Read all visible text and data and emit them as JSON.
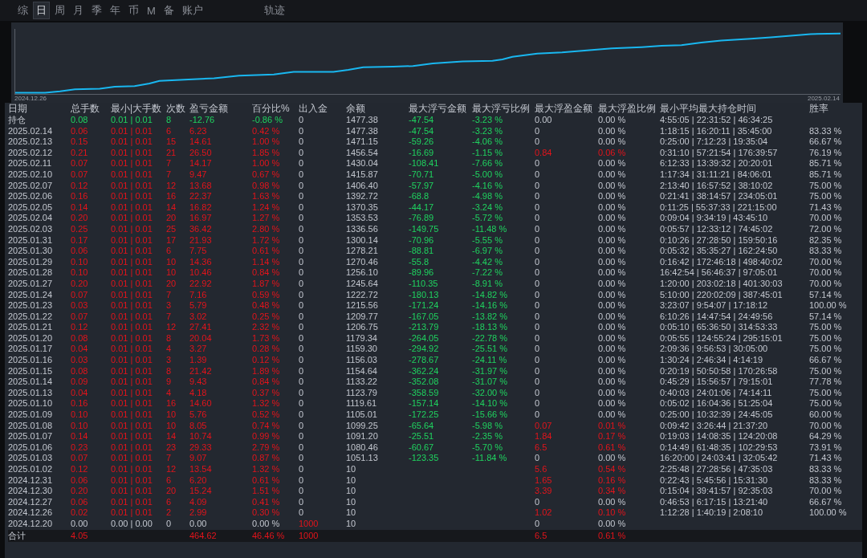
{
  "tabs": [
    {
      "label": "综",
      "selected": false
    },
    {
      "label": "日",
      "selected": true
    },
    {
      "label": "周",
      "selected": false
    },
    {
      "label": "月",
      "selected": false
    },
    {
      "label": "季",
      "selected": false
    },
    {
      "label": "年",
      "selected": false
    },
    {
      "label": "币",
      "selected": false
    },
    {
      "label": "M",
      "selected": false
    },
    {
      "label": "备",
      "selected": false
    },
    {
      "label": "账户",
      "selected": false
    }
  ],
  "view_label": "轨迹",
  "chart": {
    "start_label": "2024.12.26",
    "end_label": "2025.02.14"
  },
  "columns": [
    "日期",
    "总手数",
    "最小|大手数",
    "次数",
    "盈亏金额",
    "百分比%",
    "出入金",
    "余额",
    "最大浮亏金额",
    "最大浮亏比例",
    "最大浮盈金额",
    "最大浮盈比例",
    "最小平均最大持仓时间",
    "胜率"
  ],
  "rows": [
    {
      "kind": "open",
      "date": "持仓",
      "lots": "0.08",
      "lot_range": "0.01 | 0.01",
      "trades": "8",
      "profit": "-12.76",
      "profit_pct": "-0.86 %",
      "deposit": "0",
      "balance": "1477.38",
      "max_float_loss": "-47.54",
      "max_float_loss_pct": "-3.23 %",
      "max_float_profit": "0.00",
      "max_float_profit_pct": "0.00 %",
      "float_profit_up": false,
      "hold_times": "4:55:05 | 22:31:52 | 46:34:25"
    },
    {
      "kind": "day",
      "date": "2025.02.14",
      "lots": "0.06",
      "lot_range": "0.01 | 0.01",
      "trades": "6",
      "profit": "6.23",
      "profit_pct": "0.42 %",
      "deposit": "0",
      "balance": "1477.38",
      "max_float_loss": "-47.54",
      "max_float_loss_pct": "-3.23 %",
      "max_float_profit": "0",
      "max_float_profit_pct": "0.00 %",
      "float_profit_up": false,
      "hold_times": "1:18:15 | 16:20:11 | 35:45:00",
      "win_rate": "83.33 %"
    },
    {
      "kind": "day",
      "date": "2025.02.13",
      "lots": "0.15",
      "lot_range": "0.01 | 0.01",
      "trades": "15",
      "profit": "14.61",
      "profit_pct": "1.00 %",
      "deposit": "0",
      "balance": "1471.15",
      "max_float_loss": "-59.26",
      "max_float_loss_pct": "-4.06 %",
      "max_float_profit": "0",
      "max_float_profit_pct": "0.00 %",
      "float_profit_up": false,
      "hold_times": "0:25:00 | 7:12:23 | 19:35:04",
      "win_rate": "66.67 %"
    },
    {
      "kind": "day",
      "date": "2025.02.12",
      "lots": "0.21",
      "lot_range": "0.01 | 0.01",
      "trades": "21",
      "profit": "26.50",
      "profit_pct": "1.85 %",
      "deposit": "0",
      "balance": "1456.54",
      "max_float_loss": "-16.69",
      "max_float_loss_pct": "-1.15 %",
      "max_float_profit": "0.84",
      "max_float_profit_pct": "0.06 %",
      "float_profit_up": true,
      "hold_times": "0:31:10 | 57:21:54 | 176:39:57",
      "win_rate": "76.19 %"
    },
    {
      "kind": "day",
      "date": "2025.02.11",
      "lots": "0.07",
      "lot_range": "0.01 | 0.01",
      "trades": "7",
      "profit": "14.17",
      "profit_pct": "1.00 %",
      "deposit": "0",
      "balance": "1430.04",
      "max_float_loss": "-108.41",
      "max_float_loss_pct": "-7.66 %",
      "max_float_profit": "0",
      "max_float_profit_pct": "0.00 %",
      "float_profit_up": false,
      "hold_times": "6:12:33 | 13:39:32 | 20:20:01",
      "win_rate": "85.71 %"
    },
    {
      "kind": "day",
      "date": "2025.02.10",
      "lots": "0.07",
      "lot_range": "0.01 | 0.01",
      "trades": "7",
      "profit": "9.47",
      "profit_pct": "0.67 %",
      "deposit": "0",
      "balance": "1415.87",
      "max_float_loss": "-70.71",
      "max_float_loss_pct": "-5.00 %",
      "max_float_profit": "0",
      "max_float_profit_pct": "0.00 %",
      "float_profit_up": false,
      "hold_times": "1:17:34 | 31:11:21 | 84:06:01",
      "win_rate": "85.71 %"
    },
    {
      "kind": "day",
      "date": "2025.02.07",
      "lots": "0.12",
      "lot_range": "0.01 | 0.01",
      "trades": "12",
      "profit": "13.68",
      "profit_pct": "0.98 %",
      "deposit": "0",
      "balance": "1406.40",
      "max_float_loss": "-57.97",
      "max_float_loss_pct": "-4.16 %",
      "max_float_profit": "0",
      "max_float_profit_pct": "0.00 %",
      "float_profit_up": false,
      "hold_times": "2:13:40 | 16:57:52 | 38:10:02",
      "win_rate": "75.00 %"
    },
    {
      "kind": "day",
      "date": "2025.02.06",
      "lots": "0.16",
      "lot_range": "0.01 | 0.01",
      "trades": "16",
      "profit": "22.37",
      "profit_pct": "1.63 %",
      "deposit": "0",
      "balance": "1392.72",
      "max_float_loss": "-68.8",
      "max_float_loss_pct": "-4.98 %",
      "max_float_profit": "0",
      "max_float_profit_pct": "0.00 %",
      "float_profit_up": false,
      "hold_times": "0:21:41 | 38:14:57 | 234:05:01",
      "win_rate": "75.00 %"
    },
    {
      "kind": "day",
      "date": "2025.02.05",
      "lots": "0.14",
      "lot_range": "0.01 | 0.01",
      "trades": "14",
      "profit": "16.82",
      "profit_pct": "1.24 %",
      "deposit": "0",
      "balance": "1370.35",
      "max_float_loss": "-44.17",
      "max_float_loss_pct": "-3.24 %",
      "max_float_profit": "0",
      "max_float_profit_pct": "0.00 %",
      "float_profit_up": false,
      "hold_times": "0:11:25 | 55:37:33 | 221:15:00",
      "win_rate": "71.43 %"
    },
    {
      "kind": "day",
      "date": "2025.02.04",
      "lots": "0.20",
      "lot_range": "0.01 | 0.01",
      "trades": "20",
      "profit": "16.97",
      "profit_pct": "1.27 %",
      "deposit": "0",
      "balance": "1353.53",
      "max_float_loss": "-76.89",
      "max_float_loss_pct": "-5.72 %",
      "max_float_profit": "0",
      "max_float_profit_pct": "0.00 %",
      "float_profit_up": false,
      "hold_times": "0:09:04 | 9:34:19 | 43:45:10",
      "win_rate": "70.00 %"
    },
    {
      "kind": "day",
      "date": "2025.02.03",
      "lots": "0.25",
      "lot_range": "0.01 | 0.01",
      "trades": "25",
      "profit": "36.42",
      "profit_pct": "2.80 %",
      "deposit": "0",
      "balance": "1336.56",
      "max_float_loss": "-149.75",
      "max_float_loss_pct": "-11.48 %",
      "max_float_profit": "0",
      "max_float_profit_pct": "0.00 %",
      "float_profit_up": false,
      "hold_times": "0:05:57 | 12:33:12 | 74:45:02",
      "win_rate": "72.00 %"
    },
    {
      "kind": "day",
      "date": "2025.01.31",
      "lots": "0.17",
      "lot_range": "0.01 | 0.01",
      "trades": "17",
      "profit": "21.93",
      "profit_pct": "1.72 %",
      "deposit": "0",
      "balance": "1300.14",
      "max_float_loss": "-70.96",
      "max_float_loss_pct": "-5.55 %",
      "max_float_profit": "0",
      "max_float_profit_pct": "0.00 %",
      "float_profit_up": false,
      "hold_times": "0:10:26 | 27:28:50 | 159:50:16",
      "win_rate": "82.35 %"
    },
    {
      "kind": "day",
      "date": "2025.01.30",
      "lots": "0.06",
      "lot_range": "0.01 | 0.01",
      "trades": "6",
      "profit": "7.75",
      "profit_pct": "0.61 %",
      "deposit": "0",
      "balance": "1278.21",
      "max_float_loss": "-88.81",
      "max_float_loss_pct": "-6.97 %",
      "max_float_profit": "0",
      "max_float_profit_pct": "0.00 %",
      "float_profit_up": false,
      "hold_times": "0:05:32 | 35:35:27 | 162:24:50",
      "win_rate": "83.33 %"
    },
    {
      "kind": "day",
      "date": "2025.01.29",
      "lots": "0.10",
      "lot_range": "0.01 | 0.01",
      "trades": "10",
      "profit": "14.36",
      "profit_pct": "1.14 %",
      "deposit": "0",
      "balance": "1270.46",
      "max_float_loss": "-55.8",
      "max_float_loss_pct": "-4.42 %",
      "max_float_profit": "0",
      "max_float_profit_pct": "0.00 %",
      "float_profit_up": false,
      "hold_times": "0:16:42 | 172:46:18 | 498:40:02",
      "win_rate": "70.00 %"
    },
    {
      "kind": "day",
      "date": "2025.01.28",
      "lots": "0.10",
      "lot_range": "0.01 | 0.01",
      "trades": "10",
      "profit": "10.46",
      "profit_pct": "0.84 %",
      "deposit": "0",
      "balance": "1256.10",
      "max_float_loss": "-89.96",
      "max_float_loss_pct": "-7.22 %",
      "max_float_profit": "0",
      "max_float_profit_pct": "0.00 %",
      "float_profit_up": false,
      "hold_times": "16:42:54 | 56:46:37 | 97:05:01",
      "win_rate": "70.00 %"
    },
    {
      "kind": "day",
      "date": "2025.01.27",
      "lots": "0.20",
      "lot_range": "0.01 | 0.01",
      "trades": "20",
      "profit": "22.92",
      "profit_pct": "1.87 %",
      "deposit": "0",
      "balance": "1245.64",
      "max_float_loss": "-110.35",
      "max_float_loss_pct": "-8.91 %",
      "max_float_profit": "0",
      "max_float_profit_pct": "0.00 %",
      "float_profit_up": false,
      "hold_times": "1:20:00 | 203:02:18 | 401:30:03",
      "win_rate": "70.00 %"
    },
    {
      "kind": "day",
      "date": "2025.01.24",
      "lots": "0.07",
      "lot_range": "0.01 | 0.01",
      "trades": "7",
      "profit": "7.16",
      "profit_pct": "0.59 %",
      "deposit": "0",
      "balance": "1222.72",
      "max_float_loss": "-180.13",
      "max_float_loss_pct": "-14.82 %",
      "max_float_profit": "0",
      "max_float_profit_pct": "0.00 %",
      "float_profit_up": false,
      "hold_times": "5:10:00 | 220:02:09 | 387:45:01",
      "win_rate": "57.14 %"
    },
    {
      "kind": "day",
      "date": "2025.01.23",
      "lots": "0.03",
      "lot_range": "0.01 | 0.01",
      "trades": "3",
      "profit": "5.79",
      "profit_pct": "0.48 %",
      "deposit": "0",
      "balance": "1215.56",
      "max_float_loss": "-171.24",
      "max_float_loss_pct": "-14.16 %",
      "max_float_profit": "0",
      "max_float_profit_pct": "0.00 %",
      "float_profit_up": false,
      "hold_times": "3:23:07 | 9:54:07 | 17:18:12",
      "win_rate": "100.00 %"
    },
    {
      "kind": "day",
      "date": "2025.01.22",
      "lots": "0.07",
      "lot_range": "0.01 | 0.01",
      "trades": "7",
      "profit": "3.02",
      "profit_pct": "0.25 %",
      "deposit": "0",
      "balance": "1209.77",
      "max_float_loss": "-167.05",
      "max_float_loss_pct": "-13.82 %",
      "max_float_profit": "0",
      "max_float_profit_pct": "0.00 %",
      "float_profit_up": false,
      "hold_times": "6:10:26 | 14:47:54 | 24:49:56",
      "win_rate": "57.14 %"
    },
    {
      "kind": "day",
      "date": "2025.01.21",
      "lots": "0.12",
      "lot_range": "0.01 | 0.01",
      "trades": "12",
      "profit": "27.41",
      "profit_pct": "2.32 %",
      "deposit": "0",
      "balance": "1206.75",
      "max_float_loss": "-213.79",
      "max_float_loss_pct": "-18.13 %",
      "max_float_profit": "0",
      "max_float_profit_pct": "0.00 %",
      "float_profit_up": false,
      "hold_times": "0:05:10 | 65:36:50 | 314:53:33",
      "win_rate": "75.00 %"
    },
    {
      "kind": "day",
      "date": "2025.01.20",
      "lots": "0.08",
      "lot_range": "0.01 | 0.01",
      "trades": "8",
      "profit": "20.04",
      "profit_pct": "1.73 %",
      "deposit": "0",
      "balance": "1179.34",
      "max_float_loss": "-264.05",
      "max_float_loss_pct": "-22.78 %",
      "max_float_profit": "0",
      "max_float_profit_pct": "0.00 %",
      "float_profit_up": false,
      "hold_times": "0:05:55 | 124:55:24 | 295:15:01",
      "win_rate": "75.00 %"
    },
    {
      "kind": "day",
      "date": "2025.01.17",
      "lots": "0.04",
      "lot_range": "0.01 | 0.01",
      "trades": "4",
      "profit": "3.27",
      "profit_pct": "0.28 %",
      "deposit": "0",
      "balance": "1159.30",
      "max_float_loss": "-294.92",
      "max_float_loss_pct": "-25.51 %",
      "max_float_profit": "0",
      "max_float_profit_pct": "0.00 %",
      "float_profit_up": false,
      "hold_times": "2:09:36 | 9:56:53 | 30:05:00",
      "win_rate": "75.00 %"
    },
    {
      "kind": "day",
      "date": "2025.01.16",
      "lots": "0.03",
      "lot_range": "0.01 | 0.01",
      "trades": "3",
      "profit": "1.39",
      "profit_pct": "0.12 %",
      "deposit": "0",
      "balance": "1156.03",
      "max_float_loss": "-278.67",
      "max_float_loss_pct": "-24.11 %",
      "max_float_profit": "0",
      "max_float_profit_pct": "0.00 %",
      "float_profit_up": false,
      "hold_times": "1:30:24 | 2:46:34 | 4:14:19",
      "win_rate": "66.67 %"
    },
    {
      "kind": "day",
      "date": "2025.01.15",
      "lots": "0.08",
      "lot_range": "0.01 | 0.01",
      "trades": "8",
      "profit": "21.42",
      "profit_pct": "1.89 %",
      "deposit": "0",
      "balance": "1154.64",
      "max_float_loss": "-362.24",
      "max_float_loss_pct": "-31.97 %",
      "max_float_profit": "0",
      "max_float_profit_pct": "0.00 %",
      "float_profit_up": false,
      "hold_times": "0:20:19 | 50:50:58 | 170:26:58",
      "win_rate": "75.00 %"
    },
    {
      "kind": "day",
      "date": "2025.01.14",
      "lots": "0.09",
      "lot_range": "0.01 | 0.01",
      "trades": "9",
      "profit": "9.43",
      "profit_pct": "0.84 %",
      "deposit": "0",
      "balance": "1133.22",
      "max_float_loss": "-352.08",
      "max_float_loss_pct": "-31.07 %",
      "max_float_profit": "0",
      "max_float_profit_pct": "0.00 %",
      "float_profit_up": false,
      "hold_times": "0:45:29 | 15:56:57 | 79:15:01",
      "win_rate": "77.78 %"
    },
    {
      "kind": "day",
      "date": "2025.01.13",
      "lots": "0.04",
      "lot_range": "0.01 | 0.01",
      "trades": "4",
      "profit": "4.18",
      "profit_pct": "0.37 %",
      "deposit": "0",
      "balance": "1123.79",
      "max_float_loss": "-358.59",
      "max_float_loss_pct": "-32.00 %",
      "max_float_profit": "0",
      "max_float_profit_pct": "0.00 %",
      "float_profit_up": false,
      "hold_times": "0:40:03 | 24:01:06 | 74:14:11",
      "win_rate": "75.00 %"
    },
    {
      "kind": "day",
      "date": "2025.01.10",
      "lots": "0.16",
      "lot_range": "0.01 | 0.01",
      "trades": "16",
      "profit": "14.60",
      "profit_pct": "1.32 %",
      "deposit": "0",
      "balance": "1119.61",
      "max_float_loss": "-157.14",
      "max_float_loss_pct": "-14.10 %",
      "max_float_profit": "0",
      "max_float_profit_pct": "0.00 %",
      "float_profit_up": false,
      "hold_times": "0:05:02 | 16:04:36 | 51:25:04",
      "win_rate": "75.00 %"
    },
    {
      "kind": "day",
      "date": "2025.01.09",
      "lots": "0.10",
      "lot_range": "0.01 | 0.01",
      "trades": "10",
      "profit": "5.76",
      "profit_pct": "0.52 %",
      "deposit": "0",
      "balance": "1105.01",
      "max_float_loss": "-172.25",
      "max_float_loss_pct": "-15.66 %",
      "max_float_profit": "0",
      "max_float_profit_pct": "0.00 %",
      "float_profit_up": false,
      "hold_times": "0:25:00 | 10:32:39 | 24:45:05",
      "win_rate": "60.00 %"
    },
    {
      "kind": "day",
      "date": "2025.01.08",
      "lots": "0.10",
      "lot_range": "0.01 | 0.01",
      "trades": "10",
      "profit": "8.05",
      "profit_pct": "0.74 %",
      "deposit": "0",
      "balance": "1099.25",
      "max_float_loss": "-65.64",
      "max_float_loss_pct": "-5.98 %",
      "max_float_profit": "0.07",
      "max_float_profit_pct": "0.01 %",
      "float_profit_up": true,
      "hold_times": "0:09:42 | 3:26:44 | 21:37:20",
      "win_rate": "70.00 %"
    },
    {
      "kind": "day",
      "date": "2025.01.07",
      "lots": "0.14",
      "lot_range": "0.01 | 0.01",
      "trades": "14",
      "profit": "10.74",
      "profit_pct": "0.99 %",
      "deposit": "0",
      "balance": "1091.20",
      "max_float_loss": "-25.51",
      "max_float_loss_pct": "-2.35 %",
      "max_float_profit": "1.84",
      "max_float_profit_pct": "0.17 %",
      "float_profit_up": true,
      "hold_times": "0:19:03 | 14:08:35 | 124:20:08",
      "win_rate": "64.29 %"
    },
    {
      "kind": "day",
      "date": "2025.01.06",
      "lots": "0.23",
      "lot_range": "0.01 | 0.01",
      "trades": "23",
      "profit": "29.33",
      "profit_pct": "2.79 %",
      "deposit": "0",
      "balance": "1080.46",
      "max_float_loss": "-60.67",
      "max_float_loss_pct": "-5.70 %",
      "max_float_profit": "6.5",
      "max_float_profit_pct": "0.61 %",
      "float_profit_up": true,
      "hold_times": "0:14:49 | 61:48:35 | 102:29:53",
      "win_rate": "73.91 %"
    },
    {
      "kind": "day",
      "date": "2025.01.03",
      "lots": "0.07",
      "lot_range": "0.01 | 0.01",
      "trades": "7",
      "profit": "9.07",
      "profit_pct": "0.87 %",
      "deposit": "0",
      "balance": "1051.13",
      "max_float_loss": "-123.35",
      "max_float_loss_pct": "-11.84 %",
      "max_float_profit": "0",
      "max_float_profit_pct": "0.00 %",
      "float_profit_up": false,
      "hold_times": "16:20:00 | 24:03:41 | 32:05:42",
      "win_rate": "71.43 %"
    },
    {
      "kind": "day",
      "date": "2025.01.02",
      "lots": "0.12",
      "lot_range": "0.01 | 0.01",
      "trades": "12",
      "profit": "13.54",
      "profit_pct": "1.32 %",
      "deposit": "0",
      "balance": "10",
      "max_float_profit": "5.6",
      "max_float_profit_pct": "0.54 %",
      "float_profit_up": true,
      "hold_times": "2:25:48 | 27:28:56 | 47:35:03",
      "win_rate": "83.33 %"
    },
    {
      "kind": "day",
      "date": "2024.12.31",
      "lots": "0.06",
      "lot_range": "0.01 | 0.01",
      "trades": "6",
      "profit": "6.20",
      "profit_pct": "0.61 %",
      "deposit": "0",
      "balance": "10",
      "max_float_profit": "1.65",
      "max_float_profit_pct": "0.16 %",
      "float_profit_up": true,
      "hold_times": "0:22:43 | 5:45:56 | 15:31:30",
      "win_rate": "83.33 %"
    },
    {
      "kind": "day",
      "date": "2024.12.30",
      "lots": "0.20",
      "lot_range": "0.01 | 0.01",
      "trades": "20",
      "profit": "15.24",
      "profit_pct": "1.51 %",
      "deposit": "0",
      "balance": "10",
      "max_float_profit": "3.39",
      "max_float_profit_pct": "0.34 %",
      "float_profit_up": true,
      "hold_times": "0:15:04 | 39:41:57 | 92:35:03",
      "win_rate": "70.00 %"
    },
    {
      "kind": "day",
      "date": "2024.12.27",
      "lots": "0.06",
      "lot_range": "0.01 | 0.01",
      "trades": "6",
      "profit": "4.09",
      "profit_pct": "0.41 %",
      "deposit": "0",
      "balance": "10",
      "max_float_profit": "0",
      "max_float_profit_pct": "0.00 %",
      "float_profit_up": false,
      "hold_times": "0:46:53 | 6:17:15 | 13:21:40",
      "win_rate": "66.67 %"
    },
    {
      "kind": "day",
      "date": "2024.12.26",
      "lots": "0.02",
      "lot_range": "0.01 | 0.01",
      "trades": "2",
      "profit": "2.99",
      "profit_pct": "0.30 %",
      "deposit": "0",
      "balance": "10",
      "max_float_profit": "1.02",
      "max_float_profit_pct": "0.10 %",
      "float_profit_up": true,
      "hold_times": "1:12:28 | 1:40:19 | 2:08:10",
      "win_rate": "100.00 %"
    },
    {
      "kind": "deposit",
      "date": "2024.12.20",
      "lots": "0.00",
      "lot_range": "0.00 | 0.00",
      "trades": "0",
      "profit": "0.00",
      "profit_pct": "0.00 %",
      "deposit": "1000",
      "balance": "10",
      "max_float_profit": "0",
      "max_float_profit_pct": "0.00 %",
      "float_profit_up": false
    }
  ],
  "total": {
    "kind": "total",
    "date": "合计",
    "lots": "4.05",
    "profit": "464.62",
    "profit_pct": "46.46 %",
    "deposit": "1000",
    "max_float_profit": "6.5",
    "max_float_profit_pct": "0.61 %",
    "float_profit_up": true
  }
}
